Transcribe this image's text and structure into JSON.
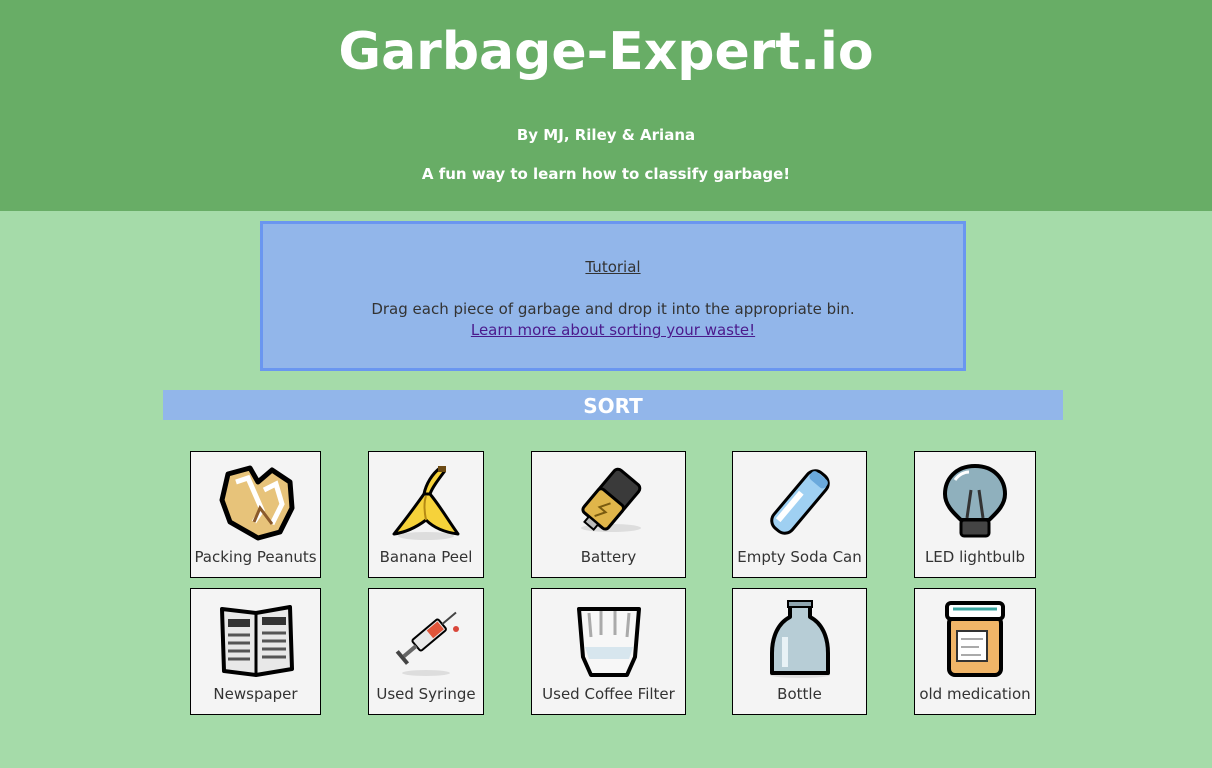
{
  "header": {
    "title": "Garbage-Expert.io",
    "byline": "By MJ, Riley & Ariana",
    "tagline": "A fun way to learn how to classify garbage!"
  },
  "tutorial": {
    "heading": "Tutorial",
    "text": "Drag each piece of garbage and drop it into the appropriate bin.",
    "link": "Learn more about sorting your waste!"
  },
  "sort": {
    "label": "SORT"
  },
  "items": [
    {
      "label": "Packing Peanuts",
      "icon": "packing-peanuts-icon"
    },
    {
      "label": "Banana Peel",
      "icon": "banana-peel-icon"
    },
    {
      "label": "Battery",
      "icon": "battery-icon"
    },
    {
      "label": "Empty Soda Can",
      "icon": "soda-can-icon"
    },
    {
      "label": "LED lightbulb",
      "icon": "lightbulb-icon"
    },
    {
      "label": "Newspaper",
      "icon": "newspaper-icon"
    },
    {
      "label": "Used Syringe",
      "icon": "syringe-icon"
    },
    {
      "label": "Used Coffee Filter",
      "icon": "coffee-filter-icon"
    },
    {
      "label": "Bottle",
      "icon": "bottle-icon"
    },
    {
      "label": "old medication",
      "icon": "medication-icon"
    }
  ]
}
